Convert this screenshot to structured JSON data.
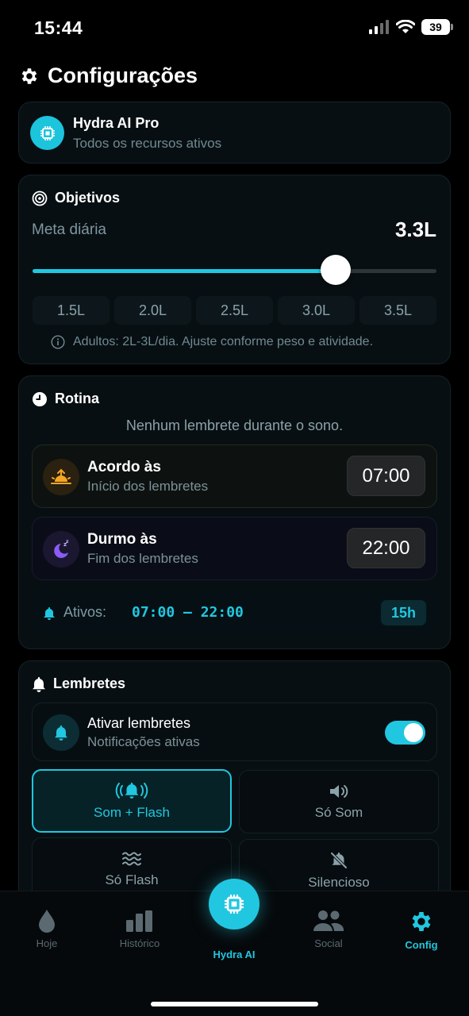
{
  "status": {
    "time": "15:44",
    "battery": "39"
  },
  "header": {
    "title": "Configurações"
  },
  "pro": {
    "name": "Hydra AI Pro",
    "subtitle": "Todos os recursos ativos"
  },
  "goals": {
    "title": "Objetivos",
    "label": "Meta diária",
    "value": "3.3L",
    "slider_fraction": 0.75,
    "presets": [
      "1.5L",
      "2.0L",
      "2.5L",
      "3.0L",
      "3.5L"
    ],
    "hint": "Adultos: 2L-3L/dia. Ajuste conforme peso e atividade."
  },
  "routine": {
    "title": "Rotina",
    "note": "Nenhum lembrete durante o sono.",
    "wake": {
      "title": "Acordo às",
      "subtitle": "Início dos lembretes",
      "time": "07:00"
    },
    "sleep": {
      "title": "Durmo às",
      "subtitle": "Fim dos lembretes",
      "time": "22:00"
    },
    "active": {
      "label": "Ativos:",
      "range": "07:00 — 22:00",
      "hours": "15h"
    }
  },
  "reminders": {
    "title": "Lembretes",
    "toggle": {
      "title": "Ativar lembretes",
      "subtitle": "Notificações ativas",
      "enabled": true
    },
    "modes": [
      "Som + Flash",
      "Só Som",
      "Só Flash",
      "Silencioso"
    ],
    "selected_mode": "Som + Flash"
  },
  "tabs": [
    "Hoje",
    "Histórico",
    "Hydra AI",
    "Social",
    "Config"
  ],
  "active_tab": "Config",
  "colors": {
    "accent": "#21c7e0",
    "background": "#000000"
  }
}
